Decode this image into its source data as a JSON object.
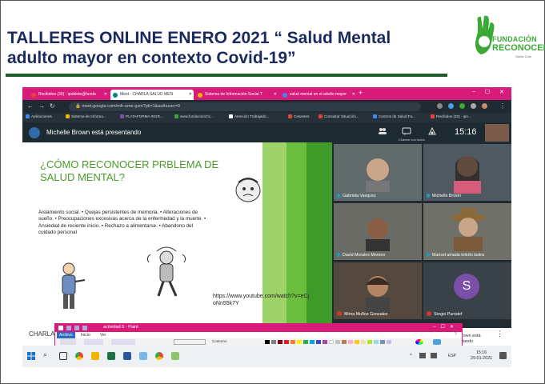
{
  "slide": {
    "title_line1": "TALLERES ONLINE ENERO 2021 “ Salud Mental",
    "title_line2": "adulto mayor en contexto Covid-19”"
  },
  "logo": {
    "line1": "FUNDACIÓN",
    "line2": "RECONOCER",
    "line3": "Santa Cruz",
    "color": "#3aa935"
  },
  "browser": {
    "tabs": [
      {
        "label": "Recibidos (30) - ipoblete@funda",
        "icon": "gmail-icon",
        "color": "#ea4335"
      },
      {
        "label": "Meet - CHARLA SALUD MEN",
        "icon": "meet-icon",
        "color": "#00897b"
      },
      {
        "label": "Sistema de Información Social T",
        "icon": "site-icon",
        "color": "#f4b400"
      },
      {
        "label": "salud mental en el adulto mayor",
        "icon": "google-icon",
        "color": "#4285f4"
      }
    ],
    "new_tab": "+",
    "url": "meet.google.com/mfr-ume-gxm?pli=1&authuser=0",
    "bookmarks": [
      {
        "label": "Aplicaciones",
        "color": "#4285f4"
      },
      {
        "label": "Sistema de Informa...",
        "color": "#f4b400"
      },
      {
        "label": "PLATAFORMA INGR...",
        "color": "#7a4fa8"
      },
      {
        "label": "www.fundacionchc...",
        "color": "#3aa935"
      },
      {
        "label": "Atención Trabajado...",
        "color": "#ffffff"
      },
      {
        "label": "Cesantes",
        "color": "#db4437"
      },
      {
        "label": "Consultar Situación...",
        "color": "#db4437"
      },
      {
        "label": "Centros de Salud Fa...",
        "color": "#4285f4"
      },
      {
        "label": "Recibidos (33) - ipo...",
        "color": "#ea4335"
      }
    ]
  },
  "meet": {
    "presenter_label": "Michelle Brown está presentando",
    "clock": "15:16",
    "chat_hint": "Chatear con todos",
    "participants": [
      {
        "name": "Gabriela Vasquez",
        "muted": false
      },
      {
        "name": "Michelle Brown",
        "muted": false
      },
      {
        "name": "David Morales Moreno",
        "muted": false
      },
      {
        "name": "Marisel amada toledo lastra",
        "muted": false
      },
      {
        "name": "Mirna Muñoz Gonzalez",
        "muted": true
      },
      {
        "name": "Sergio Purralef",
        "muted": true
      }
    ],
    "avatar_letter": "S",
    "bottom_left": "CHARLA",
    "bottom_presenting": "Michelle Brown está presentando",
    "more": "⋮"
  },
  "presentation": {
    "heading": "¿CÓMO RECONOCER PRBLEMA DE SALUD MENTAL?",
    "body": "Aislamiento social. • Quejas persistentes de memoria. • Alteraciones de sueño. • Preocupaciones excesivas acerca de la enfermedad y la muerte. • Ansiedad de reciente inicio. • Rechazo a alimentarse. • Abandono del cuidado personal",
    "link": "https://www.youtube.com/watch?v=eCj oNn55k7Y"
  },
  "paint": {
    "title": "actividad 5 - Paint",
    "menu": [
      "Archivo",
      "Inicio",
      "Ver"
    ],
    "shapes_label": "Contorno",
    "colors": [
      "#000000",
      "#7f7f7f",
      "#880015",
      "#ed1c24",
      "#ff7f27",
      "#fff200",
      "#22b14c",
      "#00a2e8",
      "#3f48cc",
      "#a349a4",
      "#ffffff",
      "#c3c3c3",
      "#b97a57",
      "#ffaec9",
      "#ffc90e",
      "#efe4b0",
      "#b5e61d",
      "#99d9ea",
      "#7092be",
      "#c8bfe7"
    ]
  },
  "taskbar": {
    "apps": [
      "windows-icon",
      "search-icon",
      "task-view-icon",
      "chrome-icon",
      "file-explorer-icon",
      "excel-icon",
      "word-icon",
      "paint-icon",
      "chrome-icon",
      "paint3d-icon"
    ],
    "lang": "ESP",
    "time": "15:16",
    "date": "29-01-2021"
  }
}
